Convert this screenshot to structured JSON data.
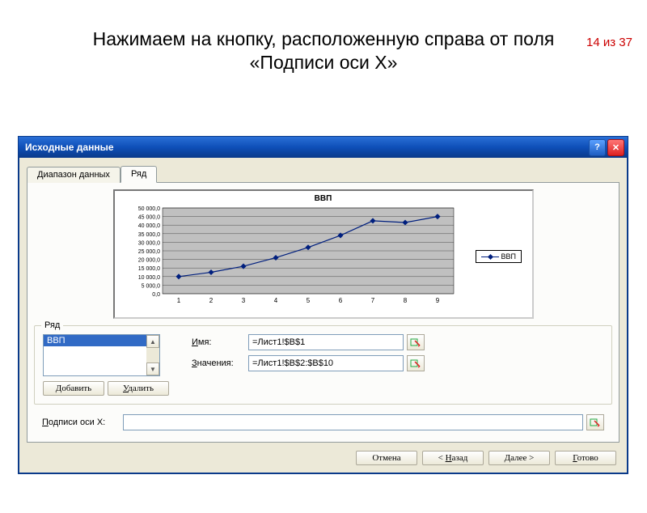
{
  "page_number": "14 из 37",
  "slide_title": "Нажимаем на кнопку, расположенную справа от поля «Подписи оси Х»",
  "window": {
    "title": "Исходные данные",
    "tabs": {
      "data_range": "Диапазон данных",
      "series": "Ряд"
    },
    "series_group": {
      "legend": "Ряд",
      "items": [
        "ВВП"
      ],
      "add": "Добавить",
      "remove": "Удалить",
      "name_label": "Имя:",
      "name_label_ul": "И",
      "name_value": "=Лист1!$B$1",
      "values_label": "начения:",
      "values_label_ul": "З",
      "values_value": "=Лист1!$B$2:$B$10"
    },
    "x_labels": {
      "label_ul": "П",
      "label": "одписи оси X:",
      "value": ""
    },
    "buttons": {
      "cancel": "Отмена",
      "back_pre": "< ",
      "back_ul": "Н",
      "back_post": "азад",
      "next_pre": "",
      "next_ul": "Д",
      "next_post": "алее >",
      "finish_pre": "",
      "finish_ul": "Г",
      "finish_post": "отово"
    }
  },
  "chart_data": {
    "type": "line",
    "title": "ВВП",
    "series": [
      {
        "name": "ВВП",
        "values": [
          10000,
          12500,
          16000,
          21000,
          27000,
          34000,
          42500,
          41500,
          45000
        ]
      }
    ],
    "categories": [
      "1",
      "2",
      "3",
      "4",
      "5",
      "6",
      "7",
      "8",
      "9"
    ],
    "ylabel": "",
    "xlabel": "",
    "ylim": [
      0,
      50000
    ],
    "yticks": [
      "0,0",
      "5 000,0",
      "10 000,0",
      "15 000,0",
      "20 000,0",
      "25 000,0",
      "30 000,0",
      "35 000,0",
      "40 000,0",
      "45 000,0",
      "50 000,0"
    ],
    "legend_position": "right",
    "grid": true
  }
}
